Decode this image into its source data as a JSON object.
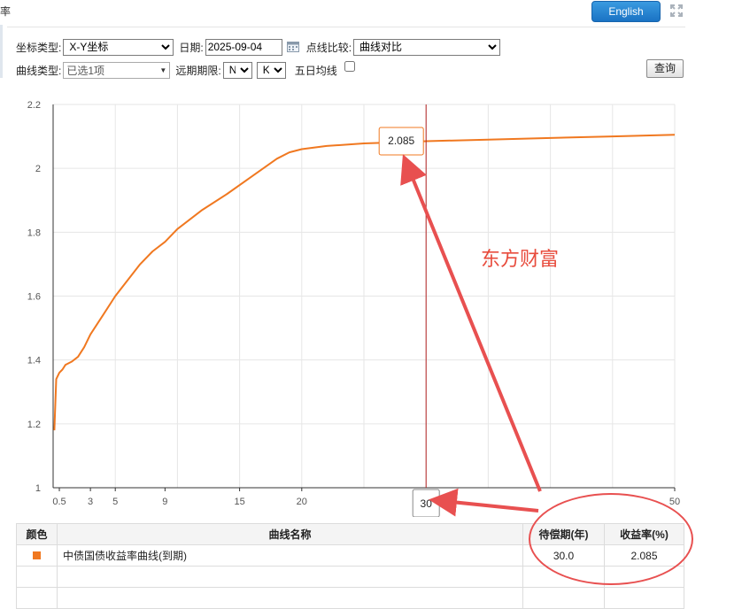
{
  "page": {
    "top_label": "率",
    "english_button": "English"
  },
  "form": {
    "coord_type_label": "坐标类型:",
    "coord_type_value": "X-Y坐标",
    "date_label": "日期:",
    "date_value": "2025-09-04",
    "compare_label": "点线比较:",
    "compare_value": "曲线对比",
    "curve_type_label": "曲线类型:",
    "curve_type_value": "已选1项",
    "forward_label": "远期期限:",
    "forward_n": "N",
    "forward_k": "K",
    "ma5_label": "五日均线",
    "query_button": "查询"
  },
  "annotations": {
    "watermark": "东方财富",
    "tooltip_value": "2.085",
    "x_marker_value": "30"
  },
  "colors": {
    "series": "#f07820",
    "crosshair": "#b22222",
    "arrow": "#e85050",
    "watermark": "#e84c3d"
  },
  "chart_data": {
    "type": "line",
    "xlim": [
      0,
      50
    ],
    "ylim": [
      1,
      2.2
    ],
    "x_ticks": [
      0.5,
      3,
      5,
      9,
      15,
      20,
      30,
      50
    ],
    "y_ticks": [
      1,
      1.2,
      1.4,
      1.6,
      1.8,
      2,
      2.2
    ],
    "grid": true,
    "crosshair_x": 30,
    "series": [
      {
        "x": [
          0.1,
          0.25,
          0.5,
          0.75,
          1,
          1.5,
          2,
          2.5,
          3,
          4,
          5,
          6,
          7,
          8,
          9,
          10,
          12,
          14,
          16,
          18,
          19,
          20,
          22,
          25,
          28,
          30,
          35,
          40,
          45,
          50
        ],
        "y": [
          1.18,
          1.34,
          1.36,
          1.37,
          1.385,
          1.395,
          1.41,
          1.44,
          1.48,
          1.54,
          1.6,
          1.65,
          1.7,
          1.74,
          1.77,
          1.81,
          1.87,
          1.92,
          1.975,
          2.03,
          2.05,
          2.06,
          2.07,
          2.078,
          2.082,
          2.085,
          2.09,
          2.095,
          2.1,
          2.105
        ]
      }
    ]
  },
  "table": {
    "headers": [
      "颜色",
      "曲线名称",
      "待偿期(年)",
      "收益率(%)"
    ],
    "rows": [
      {
        "name": "中债国债收益率曲线(到期)",
        "term": "30.0",
        "yield": "2.085"
      }
    ]
  }
}
